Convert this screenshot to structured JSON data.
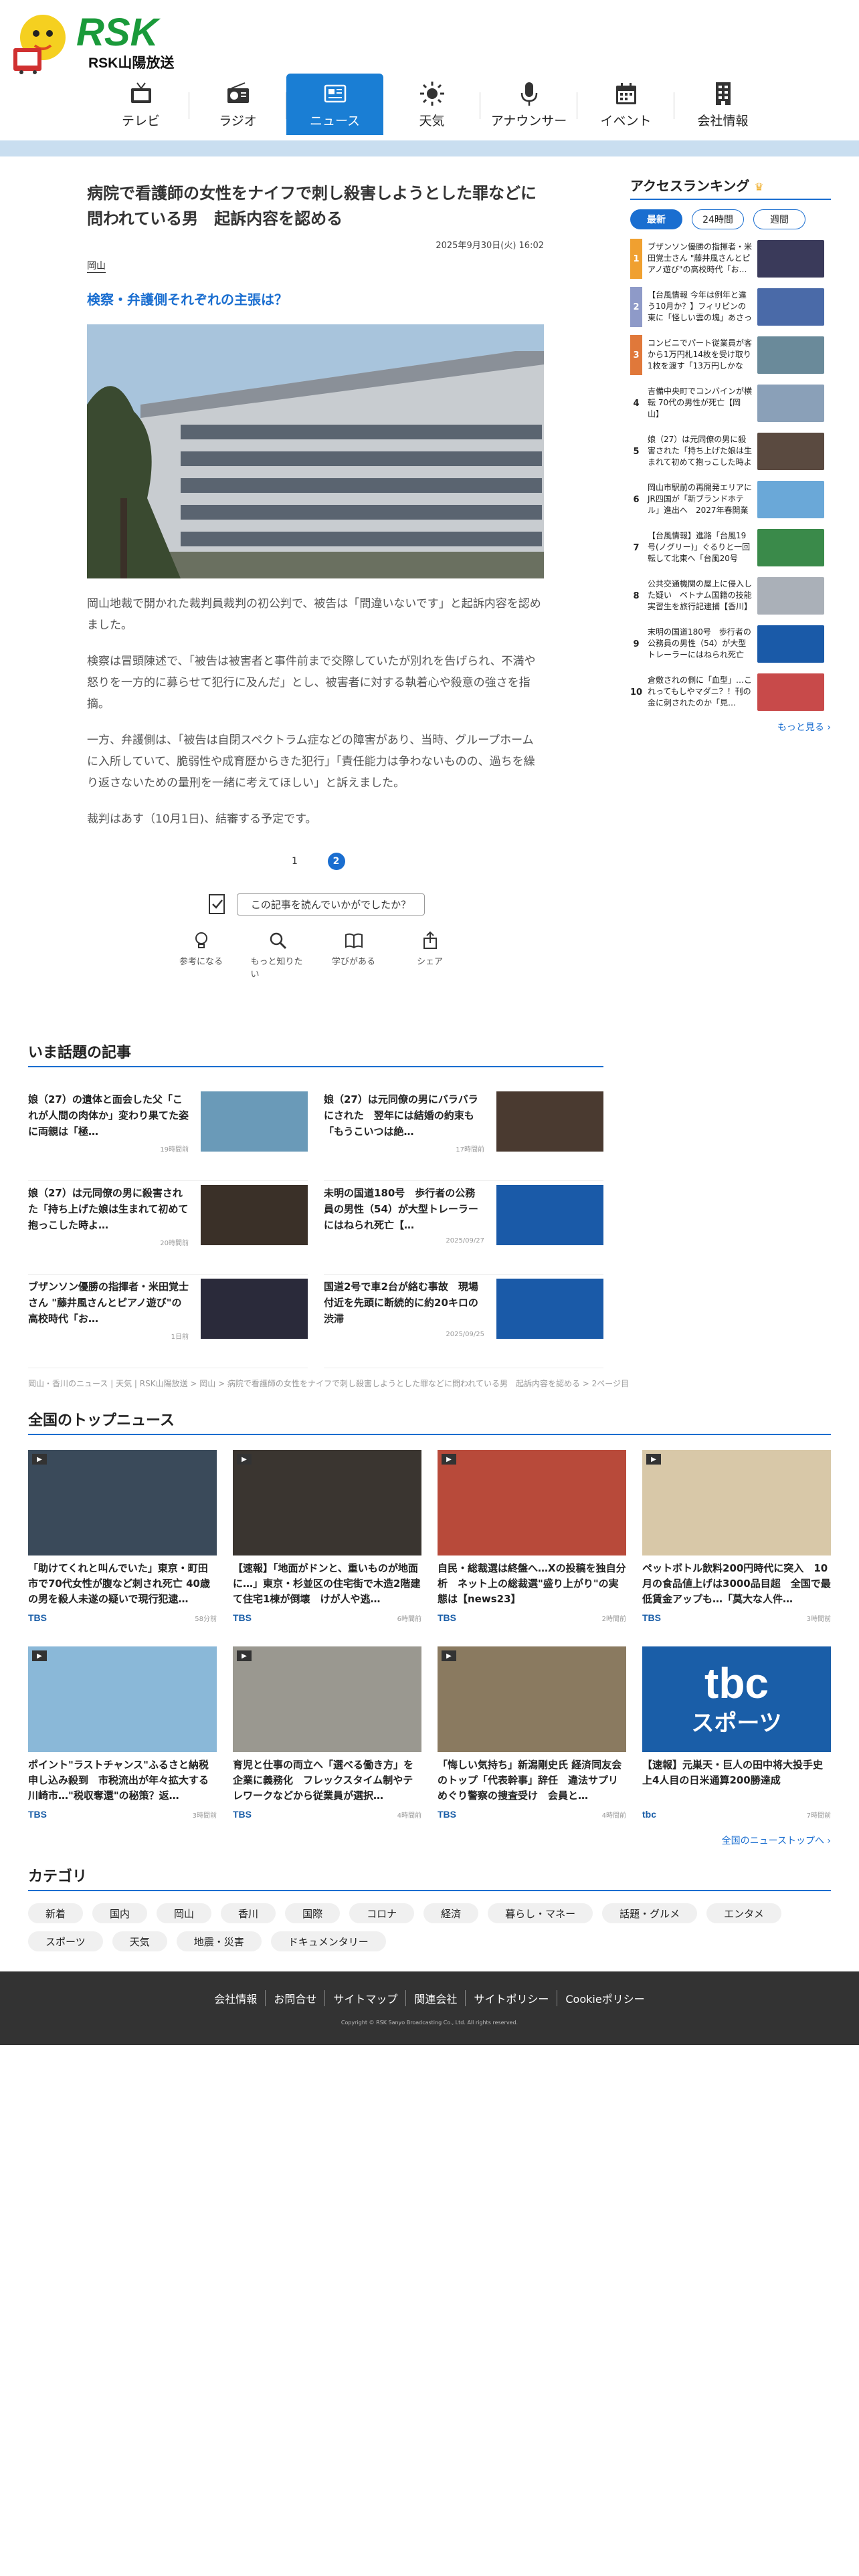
{
  "site": {
    "logo_text": "RSK山陽放送"
  },
  "nav": [
    {
      "label": "テレビ",
      "icon": "tv-icon"
    },
    {
      "label": "ラジオ",
      "icon": "radio-icon"
    },
    {
      "label": "ニュース",
      "icon": "news-icon",
      "active": true
    },
    {
      "label": "天気",
      "icon": "sun-icon"
    },
    {
      "label": "アナウンサー",
      "icon": "microphone-icon"
    },
    {
      "label": "イベント",
      "icon": "calendar-icon"
    },
    {
      "label": "会社情報",
      "icon": "building-icon"
    }
  ],
  "article": {
    "title": "病院で看護師の女性をナイフで刺し殺害しようとした罪などに問われている男　起訴内容を認める",
    "date": "2025年9月30日(火) 16:02",
    "tag": "岡山",
    "subtitle": "検察・弁護側それぞれの主張は？",
    "paragraphs": [
      "岡山地裁で開かれた裁判員裁判の初公判で、被告は「間違いないです」と起訴内容を認めました。",
      "検察は冒頭陳述で、「被告は被害者と事件前まで交際していたが別れを告げられ、不満や怒りを一方的に募らせて犯行に及んだ」とし、被害者に対する執着心や殺意の強さを指摘。",
      "一方、弁護側は、「被告は自閉スペクトラム症などの障害があり、当時、グループホームに入所していて、脆弱性や成育歴からきた犯行」「責任能力は争わないものの、過ちを繰り返さないための量刑を一緒に考えてほしい」と訴えました。",
      "裁判はあす（10月1日)、結審する予定です。"
    ],
    "pages": [
      "1",
      "2"
    ],
    "feedback_question": "この記事を読んでいかがでしたか？",
    "reactions": [
      {
        "label": "参考になる",
        "icon": "lightbulb-icon"
      },
      {
        "label": "もっと知りたい",
        "icon": "magnifier-icon"
      },
      {
        "label": "学びがある",
        "icon": "book-icon"
      },
      {
        "label": "シェア",
        "icon": "share-icon"
      }
    ]
  },
  "ranking": {
    "title": "アクセスランキング",
    "tabs": [
      "最新",
      "24時間",
      "週間"
    ],
    "items": [
      {
        "rank": "1",
        "text": "ブザンソン優勝の指揮者・米田覚士さん \"藤井風さんとピアノ遊び\"の高校時代「お…",
        "color": "#f0a030",
        "img": "#3a3a5a"
      },
      {
        "rank": "2",
        "text": "【台風情報 今年は例年と違う10月か？】フィリピンの東に「怪しい雲の塊」あさって…",
        "color": "#8e9ac8",
        "img": "#4a6aa8"
      },
      {
        "rank": "3",
        "text": "コンビニでパート従業員が客から1万円札14枚を受け取り1枚を渡す「13万円しかなけ…",
        "color": "#e0783a",
        "img": "#6a8a9a"
      },
      {
        "rank": "4",
        "text": "吉備中央町でコンバインが横転 70代の男性が死亡【岡山】",
        "color": "#ffffff",
        "img": "#8aa0b8"
      },
      {
        "rank": "5",
        "text": "娘（27）は元同僚の男に殺害された「持ち上げた娘は生まれて初めて抱っこした時より…",
        "color": "#ffffff",
        "img": "#5a4a40"
      },
      {
        "rank": "6",
        "text": "岡山市駅前の再開発エリアにJR四国が「新ブランドホテル」進出へ　2027年春開業予定",
        "color": "#ffffff",
        "img": "#6aa8d8"
      },
      {
        "rank": "7",
        "text": "【台風情報】進路「台風19号(ノグリー)」ぐるりと一回転して北東へ「台風20号（ブ…",
        "color": "#ffffff",
        "img": "#3a8a4a"
      },
      {
        "rank": "8",
        "text": "公共交通機関の屋上に侵入した疑い　ベトナム国籍の技能実習生を旅行記逮捕【香川】",
        "color": "#ffffff",
        "img": "#aab0b8"
      },
      {
        "rank": "9",
        "text": "末明の国道180号　歩行者の公務員の男性（54）が大型トレーラーにはねられ死亡【岡…",
        "color": "#ffffff",
        "img": "#1a5aa8"
      },
      {
        "rank": "10",
        "text": "倉敷されの側に「血型」…これってもしやマダニ？！刊の金に刺されたのか「見…",
        "color": "#ffffff",
        "img": "#c84a4a"
      }
    ],
    "more": "もっと見る ›"
  },
  "hot": {
    "title": "いま話題の記事",
    "items": [
      {
        "text": "娘（27）の遺体と面会した父「これが人間の肉体か」変わり果てた姿に両親は「極…",
        "date": "19時間前",
        "img": "#6a9ab8"
      },
      {
        "text": "娘（27）は元同僚の男にバラバラにされた　翌年には結婚の約束も「もうこいつは絶…",
        "date": "17時間前",
        "img": "#4a3a30"
      },
      {
        "text": "娘（27）は元同僚の男に殺害された「持ち上げた娘は生まれて初めて抱っこした時よ…",
        "date": "20時間前",
        "img": "#3a3028"
      },
      {
        "text": "未明の国道180号　歩行者の公務員の男性（54）が大型トレーラーにはねられ死亡【…",
        "date": "2025/09/27",
        "img": "#1a5aa8"
      },
      {
        "text": "ブザンソン優勝の指揮者・米田覚士さん \"藤井風さんとピアノ遊び\"の高校時代「お…",
        "date": "1日前",
        "img": "#2a2a3a"
      },
      {
        "text": "国道2号で車2台が絡む事故　現場付近を先頭に断続的に約20キロの渋滞",
        "date": "2025/09/25",
        "img": "#1a5aa8"
      }
    ]
  },
  "breadcrumb": "岡山・香川のニュース | 天気 | RSK山陽放送 > 岡山 > 病院で看護師の女性をナイフで刺し殺害しようとした罪などに問われている男　起訴内容を認める > 2ページ目",
  "national": {
    "title": "全国のトップニュース",
    "items": [
      {
        "text": "「助けてくれと叫んでいた」東京・町田市で70代女性が腹など刺され死亡 40歳の男を殺人未遂の疑いで現行犯逮…",
        "source": "TBS",
        "date": "58分前",
        "img": "#3a4a5a",
        "video": true
      },
      {
        "text": "【速報】「地面がドンと、重いものが地面に…」東京・杉並区の住宅街で木造2階建て住宅1棟が倒壊　けが人や逃…",
        "source": "TBS",
        "date": "6時間前",
        "img": "#3a3530",
        "video": true
      },
      {
        "text": "自民・総裁選は終盤へ…Xの投稿を独自分析　ネット上の総裁選\"盛り上がり\"の実態は【news23】",
        "source": "TBS",
        "date": "2時間前",
        "img": "#b84a3a",
        "video": true
      },
      {
        "text": "ペットボトル飲料200円時代に突入　10月の食品値上げは3000品目超　全国で最低賃金アップも…「莫大な人件…",
        "source": "TBS",
        "date": "3時間前",
        "img": "#d8c8a8",
        "video": true
      },
      {
        "text": "ポイント\"ラストチャンス\"ふるさと納税申し込み殺到　市税流出が年々拡大する川崎市…\"税収奪還\"の秘策？返…",
        "source": "TBS",
        "date": "3時間前",
        "img": "#8ab8d8",
        "video": true
      },
      {
        "text": "育児と仕事の両立へ「選べる働き方」を企業に義務化　フレックスタイム制やテレワークなどから従業員が選択…",
        "source": "TBS",
        "date": "4時間前",
        "img": "#9a9890",
        "video": true
      },
      {
        "text": "「悔しい気持ち」新潟剛史氏 経済同友会のトップ「代表幹事」辞任　違法サプリめぐり警察の捜査受け　会員と…",
        "source": "TBS",
        "date": "4時間前",
        "img": "#8a7a60",
        "video": true
      },
      {
        "text": "【速報】元巣天・巨人の田中将大投手史上4人目の日米通算200勝達成",
        "source": "tbc",
        "date": "7時間前",
        "img": "#1a5ea8",
        "video": false,
        "banner": "tbc",
        "banner_sub": "スポーツ"
      }
    ],
    "more": "全国のニューストップへ ›"
  },
  "category": {
    "title": "カテゴリ",
    "items": [
      "新着",
      "国内",
      "岡山",
      "香川",
      "国際",
      "コロナ",
      "経済",
      "暮らし・マネー",
      "話題・グルメ",
      "エンタメ",
      "スポーツ",
      "天気",
      "地震・災害",
      "ドキュメンタリー"
    ]
  },
  "footer": {
    "links": [
      "会社情報",
      "お問合せ",
      "サイトマップ",
      "関連会社",
      "サイトポリシー",
      "Cookieポリシー"
    ],
    "copyright": "Copyright © RSK Sanyo Broadcasting Co., Ltd. All rights reserved."
  },
  "colors": {
    "accent": "#1a7ed4",
    "link": "#1a6ed0",
    "band": "#c9def0",
    "footer": "#333333"
  }
}
